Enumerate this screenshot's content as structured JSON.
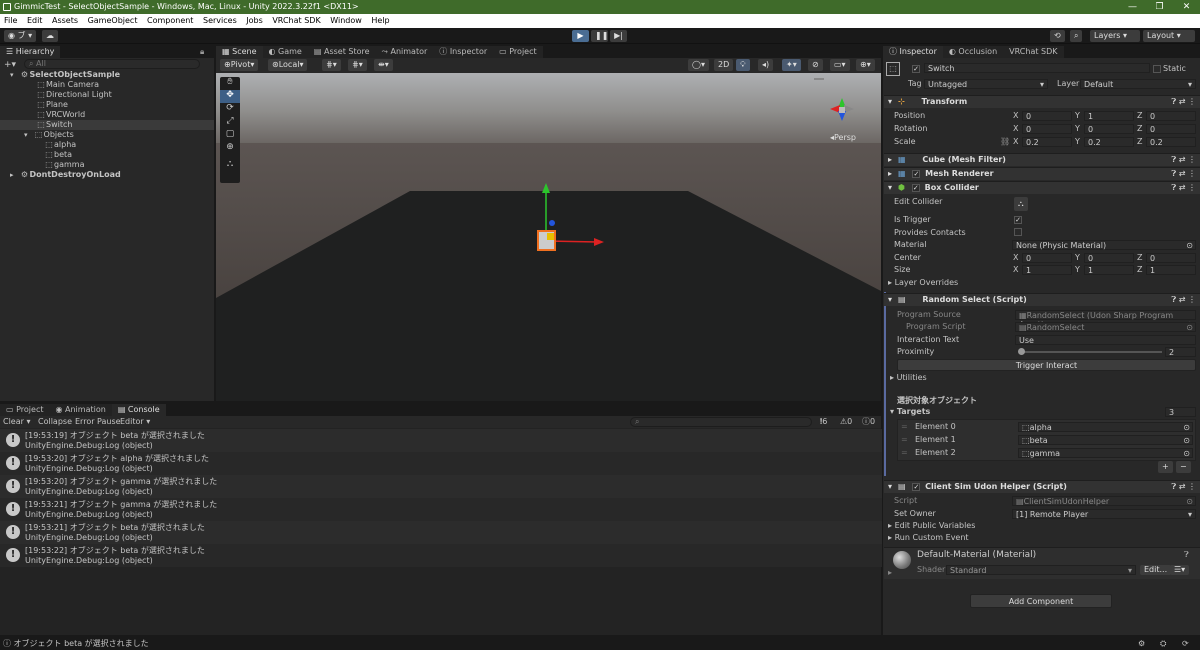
{
  "window": {
    "title": "GimmicTest - SelectObjectSample - Windows, Mac, Linux - Unity 2022.3.22f1 <DX11>",
    "controls": [
      "—",
      "❐",
      "✕"
    ]
  },
  "menu": [
    "File",
    "Edit",
    "Assets",
    "GameObject",
    "Component",
    "Services",
    "Jobs",
    "VRChat SDK",
    "Window",
    "Help"
  ],
  "toolbar": {
    "account": "ブ",
    "layers": "Layers",
    "layout": "Layout"
  },
  "hierarchy": {
    "tab": "Hierarchy",
    "search_placeholder": "All",
    "items": [
      {
        "label": "SelectObjectSample",
        "depth": 0,
        "type": "scene"
      },
      {
        "label": "Main Camera",
        "depth": 1,
        "type": "cube"
      },
      {
        "label": "Directional Light",
        "depth": 1,
        "type": "cube"
      },
      {
        "label": "Plane",
        "depth": 1,
        "type": "cube"
      },
      {
        "label": "VRCWorld",
        "depth": 1,
        "type": "cube"
      },
      {
        "label": "Switch",
        "depth": 1,
        "type": "cube",
        "selected": true
      },
      {
        "label": "Objects",
        "depth": 1,
        "type": "cube"
      },
      {
        "label": "alpha",
        "depth": 2,
        "type": "cube"
      },
      {
        "label": "beta",
        "depth": 2,
        "type": "cube"
      },
      {
        "label": "gamma",
        "depth": 2,
        "type": "cube"
      },
      {
        "label": "DontDestroyOnLoad",
        "depth": 0,
        "type": "scene"
      }
    ]
  },
  "scene": {
    "tabs": [
      "Scene",
      "Game",
      "Asset Store",
      "Animator",
      "Inspector",
      "Project"
    ],
    "pivot": "Pivot",
    "local": "Local",
    "mode2d": "2D",
    "persp": "Persp"
  },
  "console": {
    "tabs": [
      "Project",
      "Animation",
      "Console"
    ],
    "buttons": [
      "Clear",
      "Collapse",
      "Error Pause",
      "Editor"
    ],
    "counts": {
      "log": "6",
      "warn": "0",
      "error": "0"
    },
    "logs": [
      {
        "line1": "[19:53:19] オブジェクト beta が選択されました",
        "line2": "UnityEngine.Debug:Log (object)"
      },
      {
        "line1": "[19:53:20] オブジェクト alpha が選択されました",
        "line2": "UnityEngine.Debug:Log (object)"
      },
      {
        "line1": "[19:53:20] オブジェクト gamma が選択されました",
        "line2": "UnityEngine.Debug:Log (object)"
      },
      {
        "line1": "[19:53:21] オブジェクト gamma が選択されました",
        "line2": "UnityEngine.Debug:Log (object)"
      },
      {
        "line1": "[19:53:21] オブジェクト beta が選択されました",
        "line2": "UnityEngine.Debug:Log (object)"
      },
      {
        "line1": "[19:53:22] オブジェクト beta が選択されました",
        "line2": "UnityEngine.Debug:Log (object)"
      }
    ]
  },
  "status": {
    "text": "オブジェクト beta が選択されました"
  },
  "inspector": {
    "tabs": [
      "Inspector",
      "Occlusion",
      "VRChat SDK"
    ],
    "object_name": "Switch",
    "static_label": "Static",
    "tag_label": "Tag",
    "tag_value": "Untagged",
    "layer_label": "Layer",
    "layer_value": "Default",
    "transform": {
      "title": "Transform",
      "position": {
        "label": "Position",
        "x": "0",
        "y": "1",
        "z": "0"
      },
      "rotation": {
        "label": "Rotation",
        "x": "0",
        "y": "0",
        "z": "0"
      },
      "scale": {
        "label": "Scale",
        "x": "0.2",
        "y": "0.2",
        "z": "0.2"
      }
    },
    "mesh_filter": "Cube (Mesh Filter)",
    "mesh_renderer": "Mesh Renderer",
    "box_collider": {
      "title": "Box Collider",
      "edit_collider": "Edit Collider",
      "is_trigger": "Is Trigger",
      "provides_contacts": "Provides Contacts",
      "material_label": "Material",
      "material_value": "None (Physic Material)",
      "center": {
        "label": "Center",
        "x": "0",
        "y": "0",
        "z": "0"
      },
      "size": {
        "label": "Size",
        "x": "1",
        "y": "1",
        "z": "1"
      },
      "layer_overrides": "Layer Overrides"
    },
    "random_select": {
      "title": "Random Select (Script)",
      "program_source_label": "Program Source",
      "program_source_value": "RandomSelect (Udon Sharp Program Asset)",
      "program_script_label": "Program Script",
      "program_script_value": "RandomSelect",
      "interaction_text_label": "Interaction Text",
      "interaction_text_value": "Use",
      "proximity_label": "Proximity",
      "proximity_value": "2",
      "trigger_interact": "Trigger Interact",
      "utilities": "Utilities",
      "section_header": "選択対象オブジェクト",
      "targets_label": "Targets",
      "targets_count": "3",
      "elements": [
        {
          "label": "Element 0",
          "value": "alpha"
        },
        {
          "label": "Element 1",
          "value": "beta"
        },
        {
          "label": "Element 2",
          "value": "gamma"
        }
      ]
    },
    "client_sim": {
      "title": "Client Sim Udon Helper (Script)",
      "script_label": "Script",
      "script_value": "ClientSimUdonHelper",
      "set_owner_label": "Set Owner",
      "set_owner_value": "[1] Remote Player",
      "edit_public_vars": "Edit Public Variables",
      "run_custom_event": "Run Custom Event"
    },
    "material": {
      "name": "Default-Material (Material)",
      "shader_label": "Shader",
      "shader_value": "Standard",
      "edit": "Edit..."
    },
    "add_component": "Add Component"
  }
}
